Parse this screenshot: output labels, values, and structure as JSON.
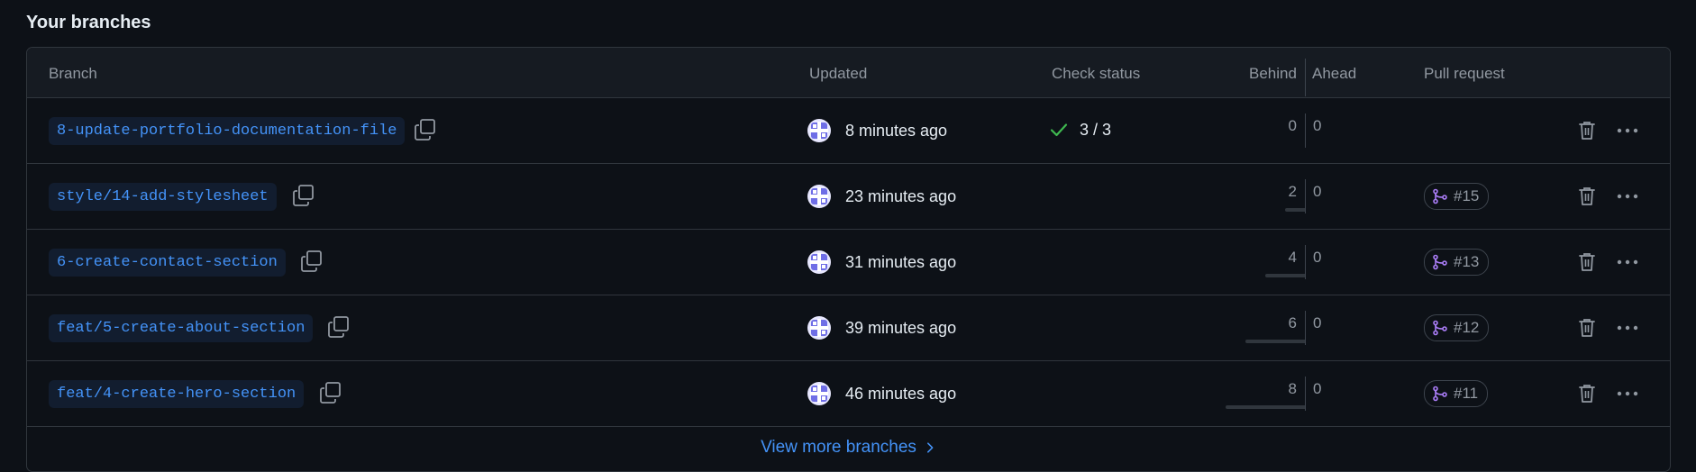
{
  "section_title": "Your branches",
  "columns": {
    "branch": "Branch",
    "updated": "Updated",
    "check_status": "Check status",
    "behind": "Behind",
    "ahead": "Ahead",
    "pull_request": "Pull request"
  },
  "branches": [
    {
      "name": "8-update-portfolio-documentation-file",
      "updated": "8 minutes ago",
      "check": "3 / 3",
      "behind": "0",
      "ahead": "0",
      "pr": ""
    },
    {
      "name": "style/14-add-stylesheet",
      "updated": "23 minutes ago",
      "check": "",
      "behind": "2",
      "ahead": "0",
      "pr": "#15"
    },
    {
      "name": "6-create-contact-section",
      "updated": "31 minutes ago",
      "check": "",
      "behind": "4",
      "ahead": "0",
      "pr": "#13"
    },
    {
      "name": "feat/5-create-about-section",
      "updated": "39 minutes ago",
      "check": "",
      "behind": "6",
      "ahead": "0",
      "pr": "#12"
    },
    {
      "name": "feat/4-create-hero-section",
      "updated": "46 minutes ago",
      "check": "",
      "behind": "8",
      "ahead": "0",
      "pr": "#11"
    }
  ],
  "view_more": "View more branches",
  "icons": {
    "copy": "copy-icon",
    "check": "check-icon",
    "pr": "git-pull-request-icon",
    "trash": "trash-icon",
    "more": "kebab-horizontal-icon",
    "chevron": "chevron-right-icon"
  },
  "colors": {
    "background": "#0d1117",
    "header_bg": "#161b22",
    "border": "#30363d",
    "link": "#4493f8",
    "success": "#3fb950",
    "muted": "#9198a1",
    "pr_open": "#ab7df8"
  }
}
